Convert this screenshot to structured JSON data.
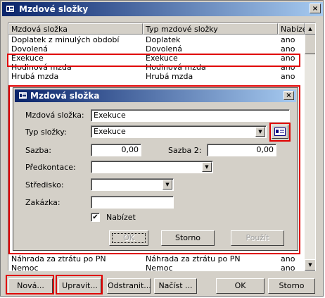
{
  "window": {
    "title": "Mzdové složky",
    "close_symbol": "×"
  },
  "list": {
    "headers": [
      "Mzdová složka",
      "Typ mzdové složky",
      "Nabízet"
    ],
    "rows_top": [
      [
        "Doplatek z minulých období",
        "Doplatek",
        "ano"
      ],
      [
        "Dovolená",
        "Dovolená",
        "ano"
      ],
      [
        "Exekuce",
        "Exekuce",
        "ano"
      ],
      [
        "Hodinová mzda",
        "Hodinová mzda",
        "ano"
      ],
      [
        "Hrubá mzda",
        "Hrubá mzda",
        "ano"
      ]
    ],
    "rows_bottom": [
      [
        "Náhrada za ztrátu po PN",
        "Náhrada za ztrátu po PN",
        "ano"
      ],
      [
        "Nemoc",
        "Nemoc",
        "ano"
      ]
    ],
    "scroll_up": "▲",
    "scroll_down": "▼"
  },
  "buttons": {
    "nova": "Nová...",
    "upravit": "Upravit...",
    "odstranit": "Odstranit...",
    "nacist": "Načíst ...",
    "ok": "OK",
    "storno": "Storno"
  },
  "dialog": {
    "title": "Mzdová složka",
    "close_symbol": "×",
    "fields": {
      "mzdova_slozka_label": "Mzdová složka:",
      "mzdova_slozka_value": "Exekuce",
      "typ_slozky_label": "Typ složky:",
      "typ_slozky_value": "Exekuce",
      "sazba_label": "Sazba:",
      "sazba_value": "0,00",
      "sazba2_label": "Sazba 2:",
      "sazba2_value": "0,00",
      "predkontace_label": "Předkontace:",
      "predkontace_value": "",
      "stredisko_label": "Středisko:",
      "stredisko_value": "",
      "zakazka_label": "Zakázka:",
      "zakazka_value": "",
      "nabizet_label": "Nabízet",
      "nabizet_checked": "✔",
      "dropdown_arrow": "▼"
    },
    "buttons": {
      "ok": "OK",
      "storno": "Storno",
      "pouzit": "Použít"
    }
  },
  "colors": {
    "highlight": "#e00000",
    "title_start": "#0a246a",
    "title_end": "#a6caf0"
  }
}
